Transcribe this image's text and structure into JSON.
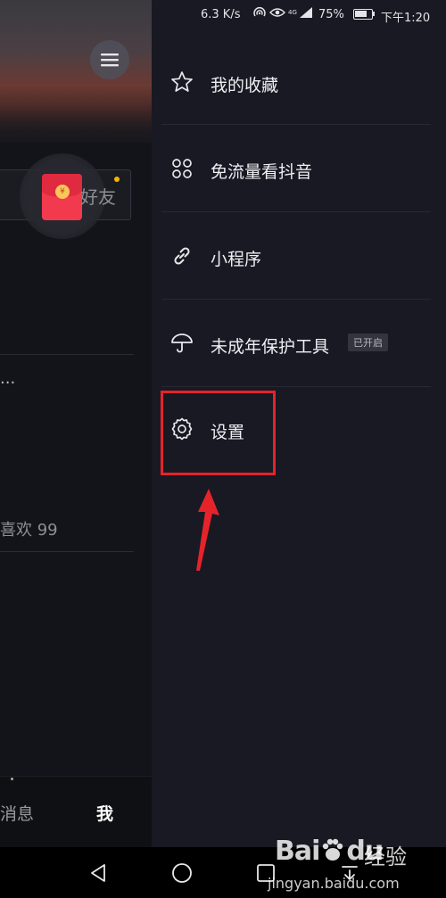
{
  "status_bar": {
    "speed": "6.3 K/s",
    "battery_percent": "75%",
    "time": "下午1:20",
    "network_label": "4G"
  },
  "profile_background": {
    "friend_button_label": "好友",
    "truncated_text": "...",
    "likes_label": "喜欢 99",
    "tabs": {
      "messages": "消息",
      "me": "我"
    }
  },
  "drawer": {
    "items": [
      {
        "label": "我的收藏",
        "icon": "star-icon"
      },
      {
        "label": "免流量看抖音",
        "icon": "grid-four-circles-icon"
      },
      {
        "label": "小程序",
        "icon": "link-icon"
      },
      {
        "label": "未成年保护工具",
        "icon": "umbrella-icon",
        "badge": "已开启"
      },
      {
        "label": "设置",
        "icon": "gear-icon"
      }
    ]
  },
  "annotation": {
    "highlight_color": "#e5232b",
    "highlighted_item": "设置"
  },
  "watermark": {
    "logo_left": "Bai",
    "logo_right": "du",
    "logo_cn": "经验",
    "url": "jingyan.baidu.com"
  },
  "colors": {
    "drawer_bg": "#181922",
    "page_bg": "#131419",
    "text": "#eeeef2",
    "accent_red": "#e5232b"
  }
}
